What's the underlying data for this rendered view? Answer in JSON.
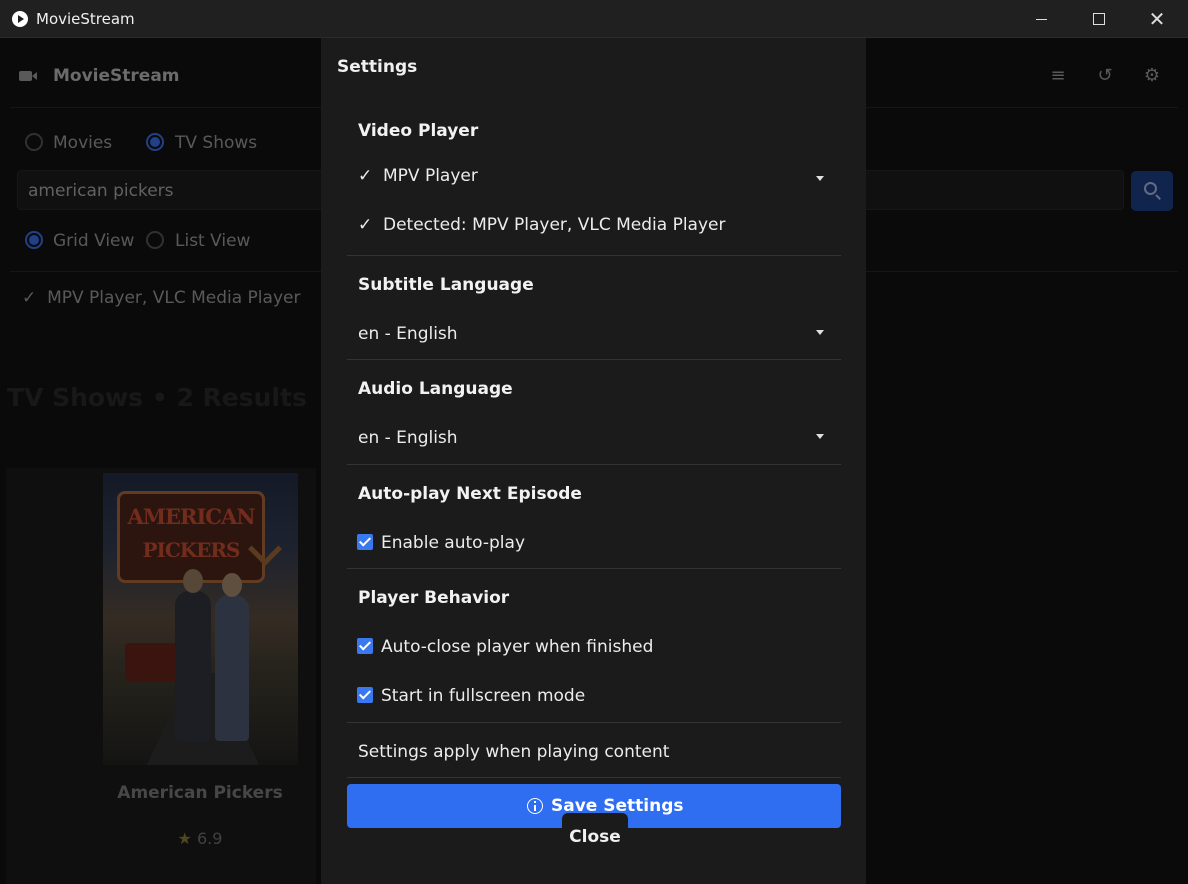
{
  "window": {
    "title": "MovieStream",
    "minimize_icon": "minimize-icon",
    "maximize_icon": "maximize-icon",
    "close_icon": "close-icon",
    "close_glyph": "✕"
  },
  "app": {
    "name": "MovieStream",
    "header_icons": [
      "queue-icon",
      "history-icon",
      "gear-icon"
    ],
    "queue_glyph": "≡",
    "history_glyph": "↺",
    "gear_glyph": "⚙",
    "content_type": {
      "options": [
        "Movies",
        "TV Shows"
      ],
      "selected": "TV Shows"
    },
    "search": {
      "value": "american pickers"
    },
    "view_mode": {
      "options": [
        "Grid View",
        "List View"
      ],
      "selected": "Grid View"
    },
    "detected_players": "MPV Player, VLC Media Player",
    "results_heading": "TV Shows • 2 Results",
    "results": [
      {
        "title": "American Pickers",
        "rating": "6.9",
        "poster_text_line1": "AMERICAN",
        "poster_text_line2": "PICKERS"
      }
    ]
  },
  "dialog": {
    "title": "Settings",
    "video_player": {
      "heading": "Video Player",
      "selected": "MPV Player",
      "detected": "Detected: MPV Player, VLC Media Player"
    },
    "subtitle_language": {
      "heading": "Subtitle Language",
      "selected": "en - English"
    },
    "audio_language": {
      "heading": "Audio Language",
      "selected": "en - English"
    },
    "autoplay": {
      "heading": "Auto-play Next Episode",
      "enable_label": "Enable auto-play",
      "enabled": true
    },
    "player_behavior": {
      "heading": "Player Behavior",
      "auto_close_label": "Auto-close player when finished",
      "auto_close": true,
      "fullscreen_label": "Start in fullscreen mode",
      "fullscreen": true
    },
    "note": "Settings apply when playing content",
    "save_label": "Save Settings",
    "close_label": "Close",
    "check_glyph": "✓"
  },
  "colors": {
    "accent": "#2f6ef0",
    "dialog_bg": "#1b1b1b",
    "app_bg": "#121212"
  }
}
